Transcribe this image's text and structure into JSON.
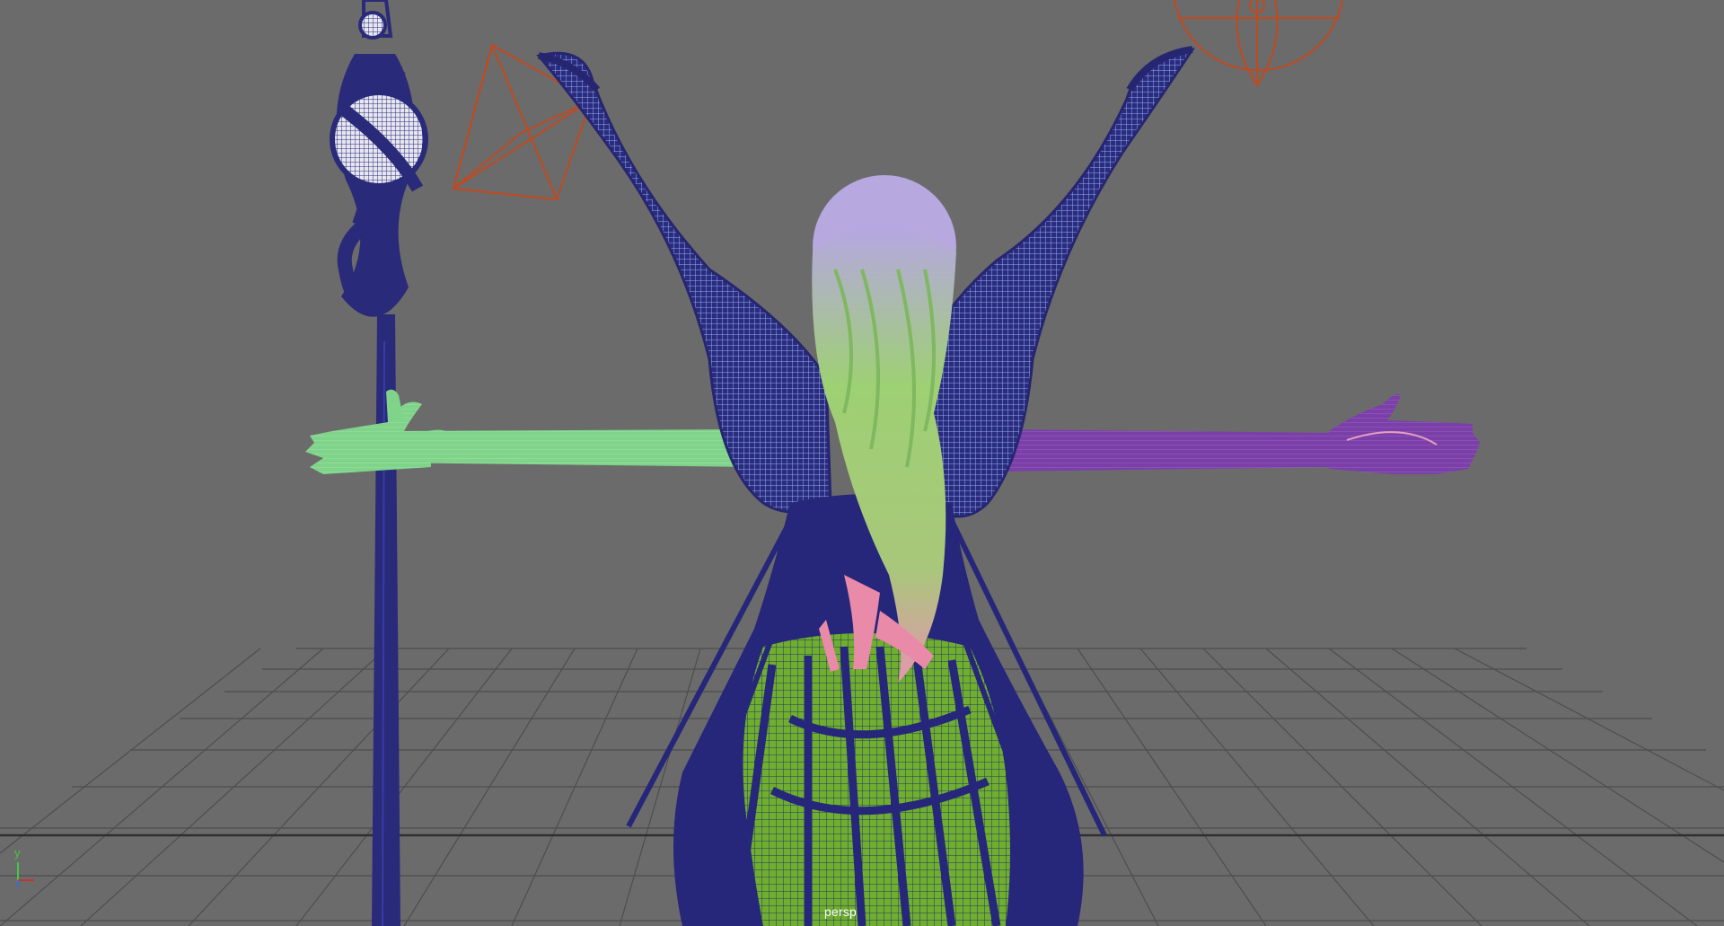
{
  "viewport": {
    "camera_label": "persp",
    "background_color": "#6b6b6b",
    "grid_color": "#4a4a4a",
    "grid_axis_color": "#2e2e2e"
  },
  "axis_gizmo": {
    "y_label": "y",
    "y_color": "#44c844",
    "x_color": "#c83232",
    "z_color": "#3c6cd8"
  },
  "scene_objects": [
    {
      "name": "staff",
      "color": "#2a2a7a",
      "wire_color": "#3a3aa8"
    },
    {
      "name": "left-wing",
      "color": "#2b2b80",
      "wire_color": "#8fb0e8"
    },
    {
      "name": "right-wing",
      "color": "#2b2b80",
      "wire_color": "#8fb0e8"
    },
    {
      "name": "left-arm",
      "color": "#7cd088"
    },
    {
      "name": "right-arm",
      "color": "#7a3ea8"
    },
    {
      "name": "hair",
      "color": "#9ad070",
      "accent": "#e89ab0"
    },
    {
      "name": "head",
      "color": "#b8a8e0"
    },
    {
      "name": "robe",
      "color": "#26267a",
      "fill": "#7fbf3a"
    },
    {
      "name": "hands",
      "color": "#e88aa8"
    },
    {
      "name": "light-locator-cube",
      "color": "#c04a20"
    },
    {
      "name": "light-locator-sphere",
      "color": "#c04a20"
    }
  ]
}
